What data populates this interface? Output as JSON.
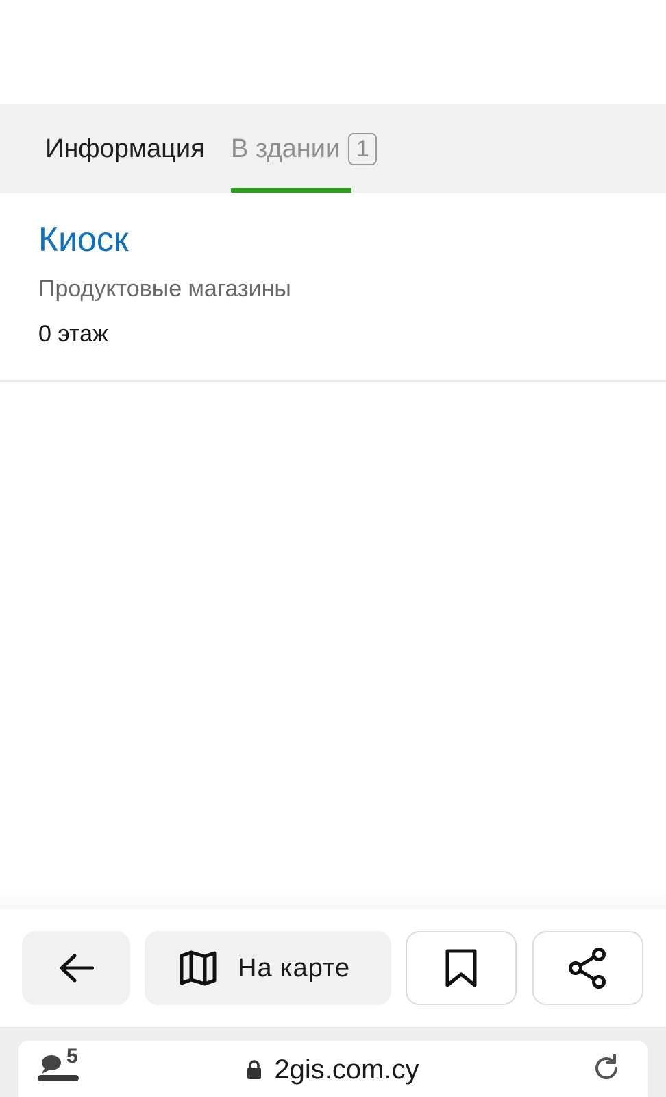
{
  "tabs": {
    "info_label": "Информация",
    "building_label": "В здании",
    "building_count": "1",
    "active": "building",
    "active_color": "#2a9d17"
  },
  "place": {
    "name": "Киоск",
    "category": "Продуктовые магазины",
    "floor": "0 этаж",
    "name_color": "#0f70c0"
  },
  "actions": {
    "back_icon": "arrow-left-icon",
    "map_icon": "map-icon",
    "map_label": "На карте",
    "bookmark_icon": "bookmark-icon",
    "share_icon": "share-icon"
  },
  "browser": {
    "tabs_count": "5",
    "url": "2gis.com.cy",
    "lock_icon": "lock-icon",
    "reload_icon": "reload-icon"
  }
}
